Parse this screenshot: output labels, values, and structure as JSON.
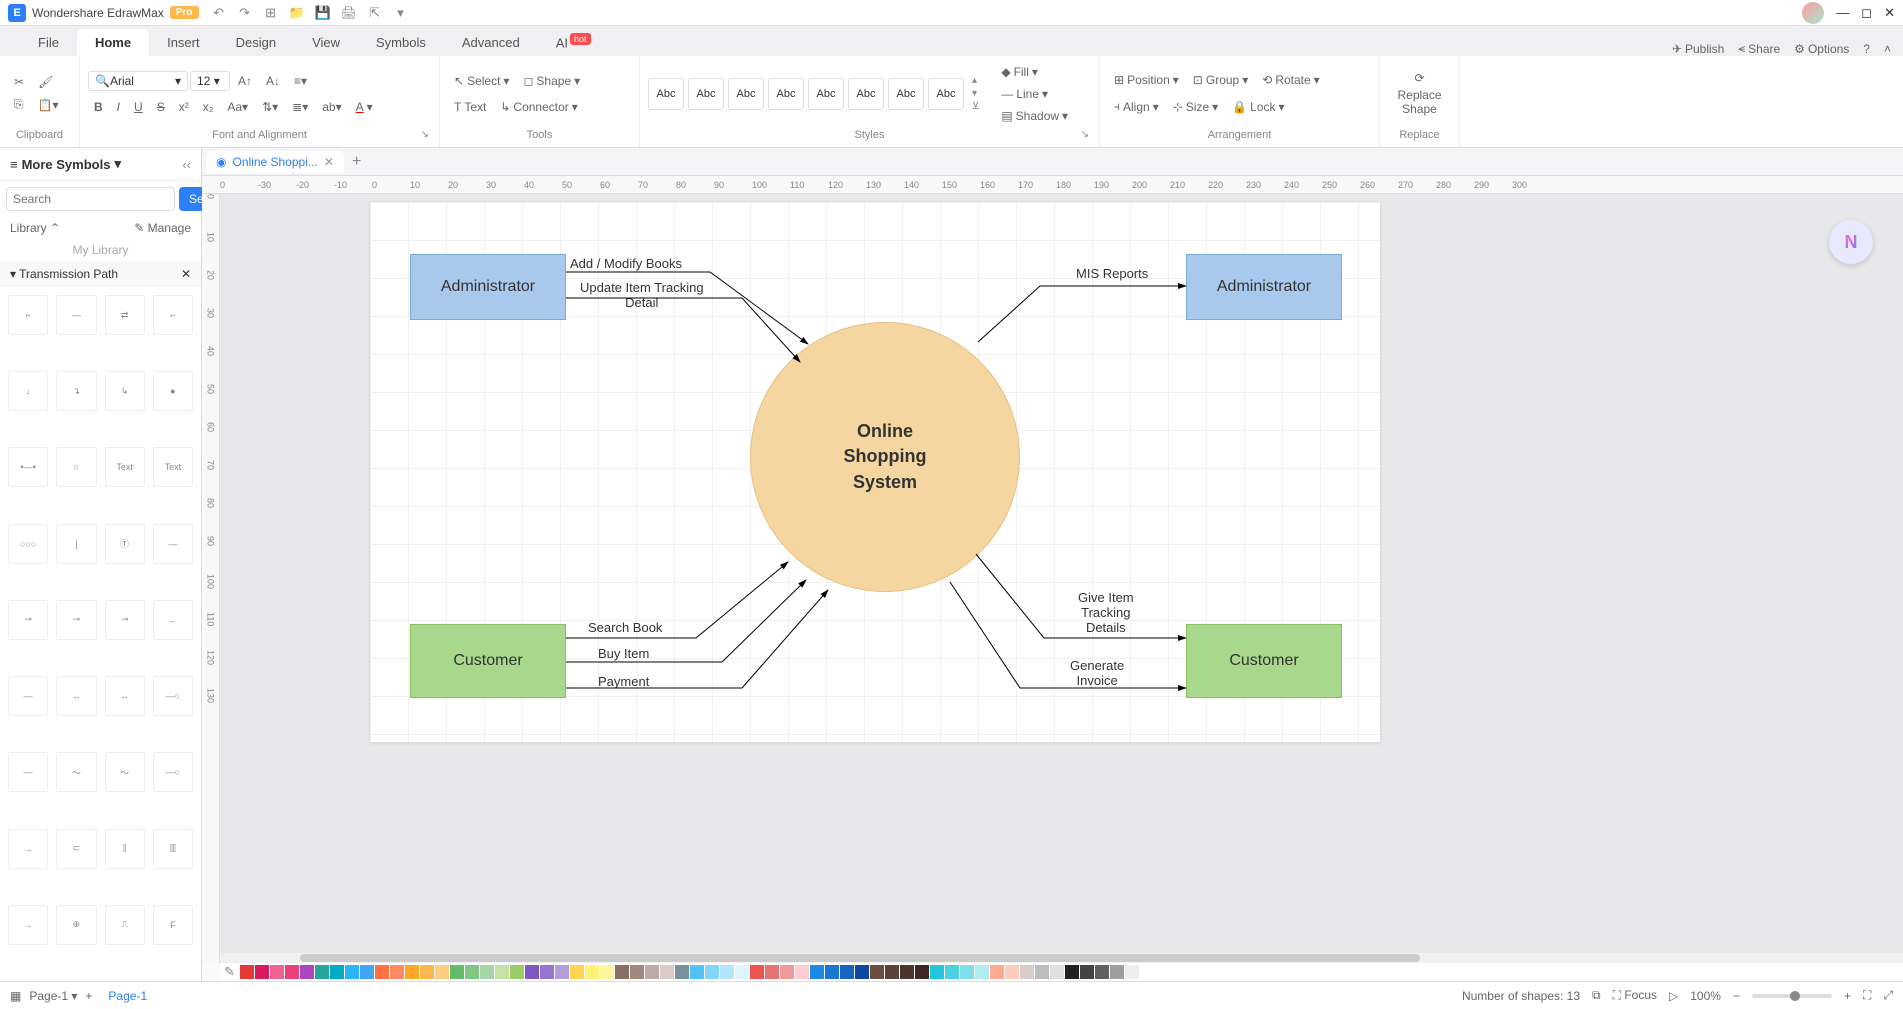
{
  "app": {
    "name": "Wondershare EdrawMax",
    "badge": "Pro"
  },
  "menu": {
    "tabs": [
      "File",
      "Home",
      "Insert",
      "Design",
      "View",
      "Symbols",
      "Advanced",
      "AI"
    ],
    "active": "Home",
    "hot": "hot",
    "right": {
      "publish": "Publish",
      "share": "Share",
      "options": "Options"
    }
  },
  "ribbon": {
    "clipboard": "Clipboard",
    "font": {
      "name": "Arial",
      "size": "12",
      "label": "Font and Alignment"
    },
    "tools": {
      "select": "Select",
      "text": "Text",
      "shape": "Shape",
      "connector": "Connector",
      "label": "Tools"
    },
    "styles": {
      "abc": "Abc",
      "label": "Styles",
      "fill": "Fill",
      "line": "Line",
      "shadow": "Shadow"
    },
    "arrange": {
      "position": "Position",
      "align": "Align",
      "group": "Group",
      "size": "Size",
      "rotate": "Rotate",
      "lock": "Lock",
      "label": "Arrangement"
    },
    "replace": {
      "btn": "Replace\nShape",
      "label": "Replace"
    }
  },
  "left": {
    "title": "More Symbols",
    "search_placeholder": "Search",
    "search_btn": "Search",
    "library": "Library",
    "manage": "Manage",
    "mylib": "My Library",
    "section": "Transmission Path"
  },
  "doc": {
    "tab": "Online Shoppi..."
  },
  "ruler_h": [
    "0",
    "-30",
    "-20",
    "-10",
    "0",
    "10",
    "20",
    "30",
    "40",
    "50",
    "60",
    "70",
    "80",
    "90",
    "100",
    "110",
    "120",
    "130",
    "140",
    "150",
    "160",
    "170",
    "180",
    "190",
    "200",
    "210",
    "220",
    "230",
    "240",
    "250",
    "260",
    "270",
    "280",
    "290",
    "300"
  ],
  "ruler_v": [
    "0",
    "10",
    "20",
    "30",
    "40",
    "50",
    "60",
    "70",
    "80",
    "90",
    "100",
    "110",
    "120",
    "130"
  ],
  "diagram": {
    "admin_left": "Administrator",
    "admin_right": "Administrator",
    "cust_left": "Customer",
    "cust_right": "Customer",
    "center": "Online\nShopping\nSystem",
    "lbl_addmod": "Add / Modify Books",
    "lbl_update": "Update Item Tracking\nDetail",
    "lbl_mis": "MIS Reports",
    "lbl_search": "Search Book",
    "lbl_buy": "Buy Item",
    "lbl_pay": "Payment",
    "lbl_track": "Give Item\nTracking\nDetails",
    "lbl_invoice": "Generate\nInvoice"
  },
  "status": {
    "page_sel": "Page-1",
    "page_tab": "Page-1",
    "shapes": "Number of shapes: 13",
    "focus": "Focus",
    "zoom": "100%"
  },
  "colors": [
    "#e53935",
    "#d81b60",
    "#f06292",
    "#ec407a",
    "#ab47bc",
    "#26a69a",
    "#00acc1",
    "#29b6f6",
    "#42a5f5",
    "#ff7043",
    "#ff8a65",
    "#ffa726",
    "#ffb74d",
    "#ffcc80",
    "#66bb6a",
    "#81c784",
    "#a5d6a7",
    "#c5e1a5",
    "#9ccc65",
    "#7e57c2",
    "#9575cd",
    "#b39ddb",
    "#ffd54f",
    "#fff176",
    "#fff59d",
    "#8d6e63",
    "#a1887f",
    "#bcaaa4",
    "#d7ccc8",
    "#78909c",
    "#4fc3f7",
    "#81d4fa",
    "#b3e5fc",
    "#e1f5fe",
    "#ef5350",
    "#e57373",
    "#ef9a9a",
    "#ffcdd2",
    "#1e88e5",
    "#1976d2",
    "#1565c0",
    "#0d47a1",
    "#6d4c41",
    "#5d4037",
    "#4e342e",
    "#3e2723",
    "#26c6da",
    "#4dd0e1",
    "#80deea",
    "#b2ebf2",
    "#ffab91",
    "#ffccbc",
    "#d7ccc8",
    "#bdbdbd",
    "#e0e0e0",
    "#212121",
    "#424242",
    "#616161",
    "#9e9e9e",
    "#eeeeee",
    "#ffffff"
  ]
}
